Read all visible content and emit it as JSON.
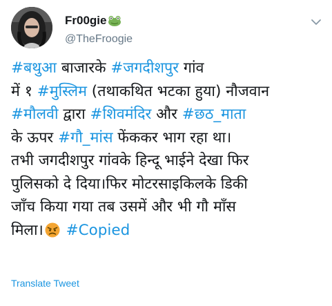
{
  "tweet": {
    "author": {
      "display_name": "Fr00gie",
      "name_emoji_icon": "frog-face-icon",
      "handle": "@TheFroogie"
    },
    "menu_icon": "chevron-down-icon",
    "lines": [
      [
        {
          "text": "#बथुआ",
          "hashtag": true
        },
        {
          "text": " बाजारके ",
          "hashtag": false
        },
        {
          "text": "#जगदीशपुर",
          "hashtag": true
        },
        {
          "text": " गांव",
          "hashtag": false
        }
      ],
      [
        {
          "text": "में १ ",
          "hashtag": false
        },
        {
          "text": "#मुस्लिम",
          "hashtag": true
        },
        {
          "text": " (तथाकथित भटका हुया) नौजवान",
          "hashtag": false
        }
      ],
      [
        {
          "text": "#मौलवी",
          "hashtag": true
        },
        {
          "text": " द्वारा ",
          "hashtag": false
        },
        {
          "text": "#शिवमंदिर",
          "hashtag": true
        },
        {
          "text": " और ",
          "hashtag": false
        },
        {
          "text": "#छठ_माता",
          "hashtag": true
        }
      ],
      [
        {
          "text": "के ऊपर ",
          "hashtag": false
        },
        {
          "text": "#गौ_मांस",
          "hashtag": true
        },
        {
          "text": " फेंककर भाग रहा था।",
          "hashtag": false
        }
      ],
      [
        {
          "text": "तभी जगदीशपुर गांवके हिन्दू भाईने देखा फिर",
          "hashtag": false
        }
      ],
      [
        {
          "text": "पुलिसको दे दिया।फिर मोटरसाइकिलके डिकी",
          "hashtag": false
        }
      ],
      [
        {
          "text": "जाँच किया गया तब उसमें और भी गौ माँस",
          "hashtag": false
        }
      ]
    ],
    "last_line": {
      "prefix": "मिला।",
      "emoji_icon": "angry-face-icon",
      "hashtag": "#Copied"
    },
    "translate_label": "Translate Tweet",
    "colors": {
      "hashtag": "#1b95e0",
      "text": "#14171a",
      "handle": "#657786"
    }
  }
}
